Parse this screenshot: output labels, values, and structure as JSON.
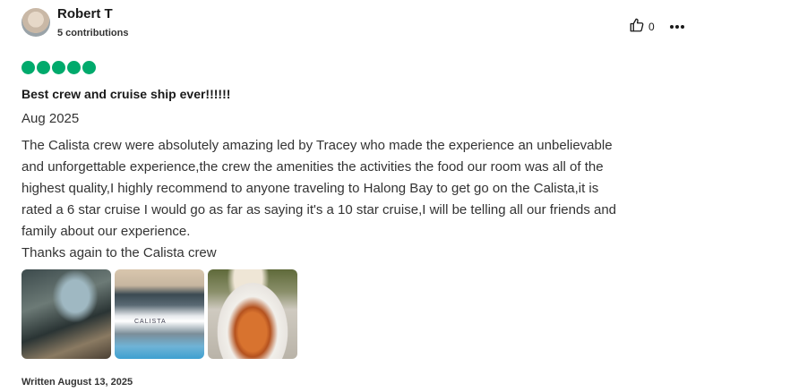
{
  "reviewer": {
    "name": "Robert T",
    "contributions": "5 contributions"
  },
  "helpful": {
    "count": "0",
    "icon": "thumbs-up-icon"
  },
  "menu": {
    "icon": "more-options-icon"
  },
  "review": {
    "rating": 5,
    "rating_color": "#00aa6c",
    "title": "Best crew and cruise ship ever!!!!!!",
    "date": "Aug 2025",
    "lines": [
      "The Calista crew were absolutely amazing led by Tracey who made the experience an unbelievable",
      "and unforgettable experience,the crew the amenities the activities the food our room was all of the",
      "highest quality,I highly recommend to anyone traveling to Halong Bay to get go on the Calista,it is",
      "rated a 6 star cruise I would go as far as saying it's a 10 star cruise,I will be telling all our friends and",
      "family about our experience.",
      "Thanks again to the Calista crew"
    ],
    "photo_brand": "CALISTA",
    "written": "Written August 13, 2025"
  }
}
